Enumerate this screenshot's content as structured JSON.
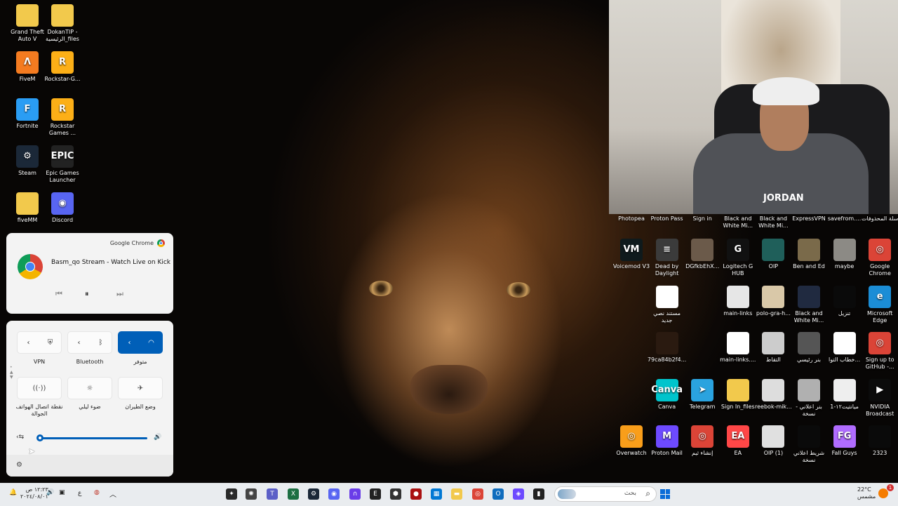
{
  "desktop_left": [
    {
      "label": "Grand Theft Auto V",
      "glyph": "",
      "color": "#f2c94c"
    },
    {
      "label": "DokanTIP - الرئيسية_files",
      "glyph": "",
      "color": "#f2c94c"
    },
    {
      "label": "FiveM",
      "glyph": "Λ",
      "color": "#f47b20"
    },
    {
      "label": "Rockstar-G...",
      "glyph": "R",
      "color": "#fcaf17"
    },
    {
      "label": "Fortnite",
      "glyph": "F",
      "color": "#2a9df4"
    },
    {
      "label": "Rockstar Games ...",
      "glyph": "R",
      "color": "#fcaf17"
    },
    {
      "label": "Steam",
      "glyph": "⚙",
      "color": "#1b2838"
    },
    {
      "label": "Epic Games Launcher",
      "glyph": "EPIC",
      "color": "#222222"
    },
    {
      "label": "fiveMM",
      "glyph": "",
      "color": "#f2c94c"
    },
    {
      "label": "Discord",
      "glyph": "◉",
      "color": "#5865f2"
    }
  ],
  "desktop_right_top_labels": [
    "Photopea",
    "Proton Pass",
    "Sign in",
    "Black and White Mi...",
    "Black and White Mi...",
    "ExpressVPN",
    "savefrom....",
    "سلة المحذوفات"
  ],
  "desktop_right": [
    {
      "label": "Voicemod V3",
      "glyph": "VM",
      "color": "#0f1a1c"
    },
    {
      "label": "Dead by Daylight",
      "glyph": "≡",
      "color": "#3b3b3b"
    },
    {
      "label": "DGfkbEhX...",
      "glyph": "",
      "color": "#6b5a4a"
    },
    {
      "label": "Logitech G HUB",
      "glyph": "G",
      "color": "#111111"
    },
    {
      "label": "OIP",
      "glyph": "",
      "color": "#1f5f5a"
    },
    {
      "label": "Ben and Ed",
      "glyph": "",
      "color": "#7a6a4a"
    },
    {
      "label": "maybe",
      "glyph": "",
      "color": "#8c8a85"
    },
    {
      "label": "Google Chrome",
      "glyph": "◎",
      "color": "#db4437"
    },
    {
      "label": "مستند نصي جديد",
      "glyph": "",
      "color": "#ffffff"
    },
    {
      "label": "main-links",
      "glyph": "",
      "color": "#e6e6e6"
    },
    {
      "label": "polo-gra-h...",
      "glyph": "",
      "color": "#d9c8a8"
    },
    {
      "label": "Black and White Mi...",
      "glyph": "",
      "color": "#202a40"
    },
    {
      "label": "تنزيل",
      "glyph": "",
      "color": "#0a0a0a"
    },
    {
      "label": "Microsoft Edge",
      "glyph": "e",
      "color": "#1b8dd6"
    },
    {
      "label": "79ca84b2f4...",
      "glyph": "",
      "color": "#2a1a10"
    },
    {
      "label": "main-links....",
      "glyph": "",
      "color": "#ffffff"
    },
    {
      "label": "التقاط",
      "glyph": "",
      "color": "#cccccc"
    },
    {
      "label": "بنر رئيسي",
      "glyph": "",
      "color": "#555555"
    },
    {
      "label": "خطاب التوا...",
      "glyph": "",
      "color": "#ffffff"
    },
    {
      "label": "Sign up to GitHub -...",
      "glyph": "◎",
      "color": "#db4437"
    },
    {
      "label": "Canva",
      "glyph": "Canva",
      "color": "#00c4cc"
    },
    {
      "label": "Telegram",
      "glyph": "➤",
      "color": "#2aa3df"
    },
    {
      "label": "Sign In_files",
      "glyph": "",
      "color": "#f2c94c"
    },
    {
      "label": "reebok-mik...",
      "glyph": "",
      "color": "#dddddd"
    },
    {
      "label": "بنر اعلاني - نسخة",
      "glyph": "",
      "color": "#b0b0b0"
    },
    {
      "label": "ميانتيت١٢-1",
      "glyph": "",
      "color": "#eeeeee"
    },
    {
      "label": "NVIDIA Broadcast",
      "glyph": "▶",
      "color": "#0b0b0b"
    },
    {
      "label": "Overwatch",
      "glyph": "◎",
      "color": "#f99e1a"
    },
    {
      "label": "Proton Mail",
      "glyph": "M",
      "color": "#6d4aff"
    },
    {
      "label": "إنشاء ثيم",
      "glyph": "◎",
      "color": "#db4437"
    },
    {
      "label": "EA",
      "glyph": "EA",
      "color": "#ff4747"
    },
    {
      "label": "OIP (1)",
      "glyph": "",
      "color": "#e0e0e0"
    },
    {
      "label": "شريط اعلاني نسخة",
      "glyph": "",
      "color": "#0a0a0a"
    },
    {
      "label": "Fall Guys",
      "glyph": "FG",
      "color": "#b06cff"
    },
    {
      "label": "2323",
      "glyph": "",
      "color": "#0a0a0a"
    }
  ],
  "webcam": {
    "shirt_text": "JORDAN"
  },
  "media": {
    "source": "Google Chrome",
    "title": "Basm_qo Stream - Watch Live on Kick",
    "prev_icon": "⏮",
    "pause_icon": "⏸",
    "next_icon": "⏭"
  },
  "quick_settings": {
    "vpn": {
      "label": "VPN",
      "chevron": "‹",
      "icon": "⛨"
    },
    "bluetooth": {
      "label": "Bluetooth",
      "chevron": "‹",
      "icon": "ᛒ"
    },
    "wifi": {
      "label": "متوفر",
      "chevron": "‹",
      "icon": "◠"
    },
    "hotspot": {
      "label": "نقطة اتصال الهواتف الجوالة",
      "icon": "((·))"
    },
    "night": {
      "label": "ضوء ليلي",
      "icon": "☼"
    },
    "airplane": {
      "label": "وضع الطيران",
      "icon": "✈"
    },
    "volume_level": 0.02,
    "volume_icon": "🔊",
    "output_icon": "‹⇆",
    "settings_icon": "⚙"
  },
  "taskbar": {
    "search_placeholder": "بحث",
    "search_icon": "⌕",
    "time": "١٢:٢٣ ص",
    "date": "٢٠٢٤/٠٨/٠١",
    "lang": "ع",
    "weather_temp": "22°C",
    "weather_desc": "مشمس",
    "notif_count": "1",
    "apps": [
      {
        "name": "figma-icon",
        "glyph": "✦",
        "color": "#2a2a2a"
      },
      {
        "name": "app-icon",
        "glyph": "✺",
        "color": "#444444"
      },
      {
        "name": "teams-icon",
        "glyph": "T",
        "color": "#5b5fc7"
      },
      {
        "name": "excel-icon",
        "glyph": "X",
        "color": "#1d6f42"
      },
      {
        "name": "steam-icon",
        "glyph": "⚙",
        "color": "#1b2838"
      },
      {
        "name": "discord-icon",
        "glyph": "◉",
        "color": "#5865f2"
      },
      {
        "name": "headset-icon",
        "glyph": "∩",
        "color": "#6a3de8"
      },
      {
        "name": "epic-icon",
        "glyph": "E",
        "color": "#222222"
      },
      {
        "name": "cube-icon",
        "glyph": "⬢",
        "color": "#333333"
      },
      {
        "name": "dbd-icon",
        "glyph": "●",
        "color": "#aa1111"
      },
      {
        "name": "store-icon",
        "glyph": "▦",
        "color": "#0078d4"
      },
      {
        "name": "folder-icon",
        "glyph": "▬",
        "color": "#f2c94c"
      },
      {
        "name": "chrome-icon",
        "glyph": "◎",
        "color": "#db4437"
      },
      {
        "name": "outlook-icon",
        "glyph": "O",
        "color": "#0f6cbd"
      },
      {
        "name": "proton-icon",
        "glyph": "◈",
        "color": "#6d4aff"
      },
      {
        "name": "terminal-icon",
        "glyph": "▮",
        "color": "#222222"
      }
    ]
  }
}
